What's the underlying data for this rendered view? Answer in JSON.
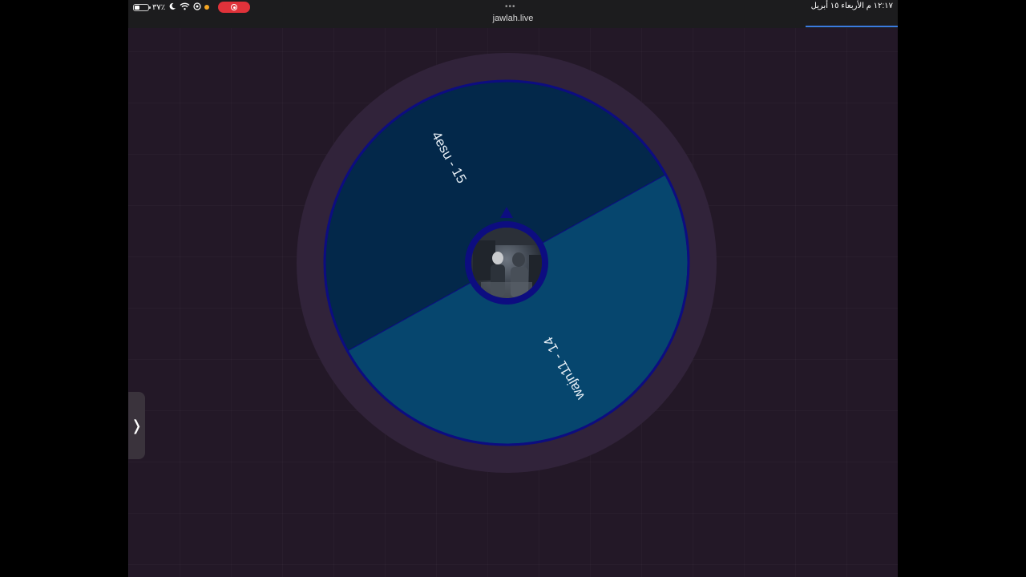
{
  "status_bar": {
    "battery_percent": "٣٧٪",
    "datetime": "١٢:١٧ م   الأربعاء ١٥ أبريل",
    "more_dots": "•••"
  },
  "browser": {
    "url": "jawlah.live",
    "loading_progress": 0.12
  },
  "wheel": {
    "segments": [
      {
        "label": "4esu - 15",
        "color": "#03284a"
      },
      {
        "label": "wajn11 - 14",
        "color": "#06466e"
      }
    ],
    "border_color": "#0d0d80",
    "frame_color": "#31233a"
  },
  "side_panel": {
    "toggle_glyph": "❭"
  },
  "icons": {
    "battery": "battery-icon",
    "moon": "moon-icon",
    "wifi": "wifi-icon",
    "location": "location-icon",
    "record": "record-icon",
    "pointer": "pointer-icon"
  }
}
